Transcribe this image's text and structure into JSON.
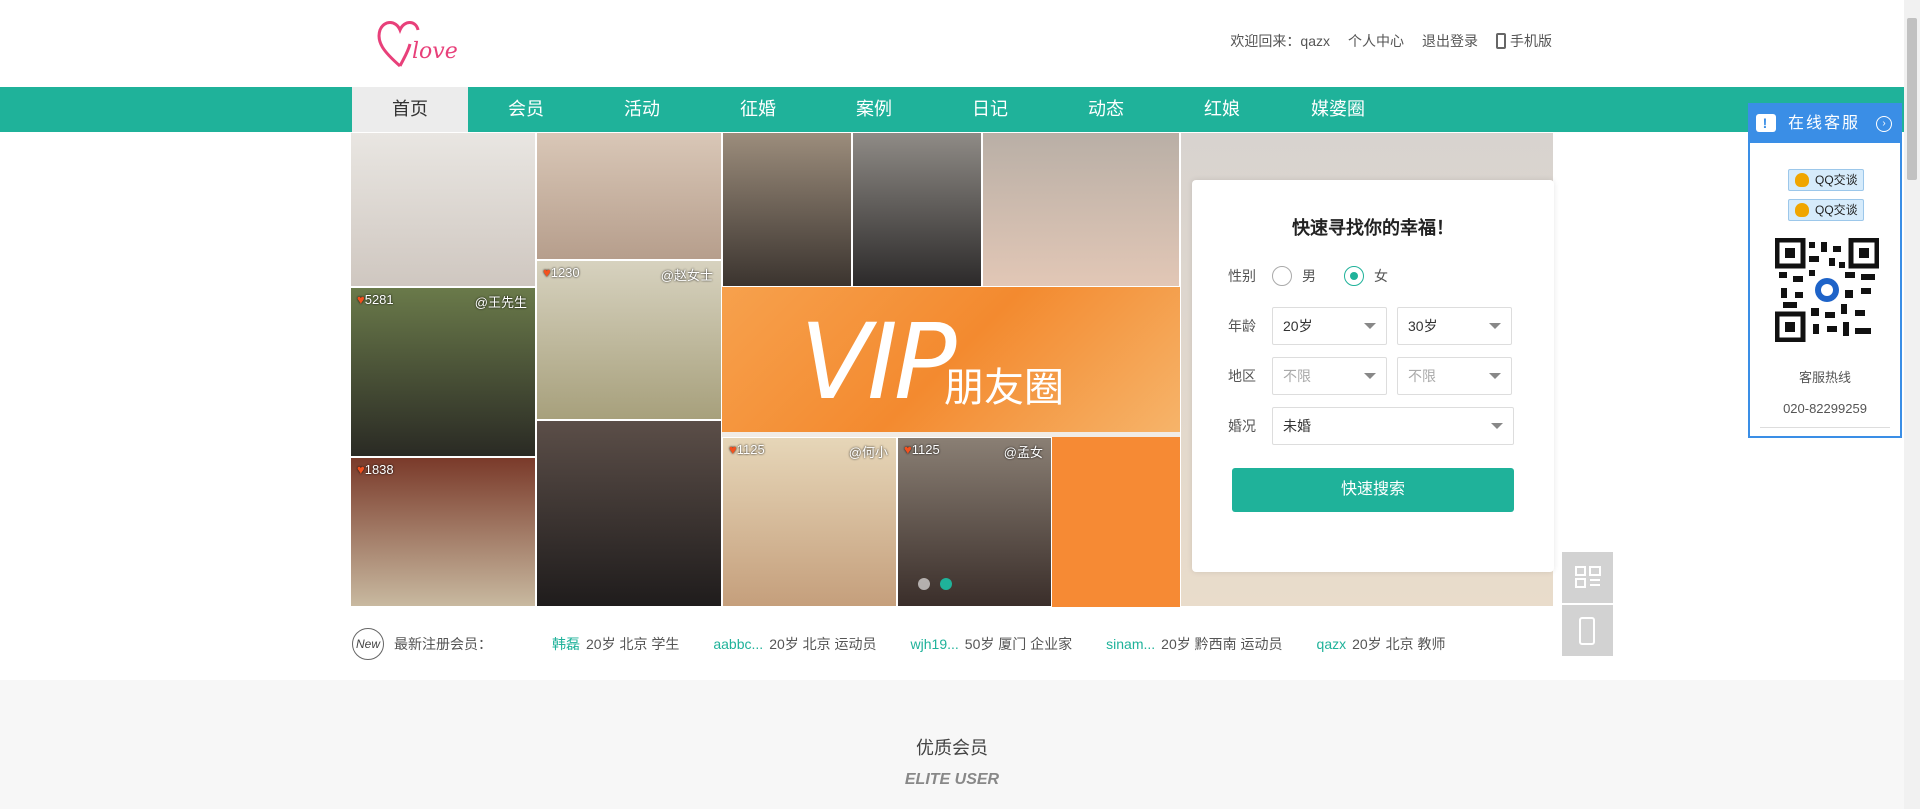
{
  "header": {
    "logo_text": "Elove",
    "welcome": "欢迎回来：qazx",
    "user_center": "个人中心",
    "logout": "退出登录",
    "mobile": "手机版"
  },
  "nav": {
    "items": [
      "首页",
      "会员",
      "活动",
      "征婚",
      "案例",
      "日记",
      "动态",
      "红娘",
      "媒婆圈"
    ],
    "active_index": 0
  },
  "banner": {
    "vip_text": "VIP",
    "vip_sub": "朋友圈",
    "tiles": [
      {
        "like": "5281",
        "who": "@王先生"
      },
      {
        "like": "1230",
        "who": "@赵女士"
      },
      {
        "like": "1838",
        "who": ""
      },
      {
        "like": "1125",
        "who": "@何小"
      },
      {
        "like": "1125",
        "who": "@孟女"
      }
    ]
  },
  "search": {
    "title": "快速寻找你的幸福！",
    "gender_label": "性别",
    "gender_male": "男",
    "gender_female": "女",
    "gender_selected": "女",
    "age_label": "年龄",
    "age_min": "20岁",
    "age_max": "30岁",
    "region_label": "地区",
    "region_province": "不限",
    "region_city": "不限",
    "marital_label": "婚况",
    "marital_value": "未婚",
    "button": "快速搜索"
  },
  "newest": {
    "badge": "New",
    "label": "最新注册会员：",
    "members": [
      {
        "name": "韩磊",
        "info": "20岁 北京 学生"
      },
      {
        "name": "aabbc...",
        "info": "20岁 北京 运动员"
      },
      {
        "name": "wjh19...",
        "info": "50岁 厦门 企业家"
      },
      {
        "name": "sinam...",
        "info": "20岁 黔西南 运动员"
      },
      {
        "name": "qazx",
        "info": "20岁 北京 教师"
      }
    ]
  },
  "section": {
    "title": "优质会员",
    "subtitle": "ELITE USER"
  },
  "service": {
    "title": "在线客服",
    "qq1": "QQ交谈",
    "qq2": "QQ交谈",
    "hotline_label": "客服热线",
    "hotline": "020-82299259"
  },
  "colors": {
    "primary": "#1fb29a",
    "service_blue": "#3a8ee6",
    "vip_orange": "#f68a34"
  }
}
